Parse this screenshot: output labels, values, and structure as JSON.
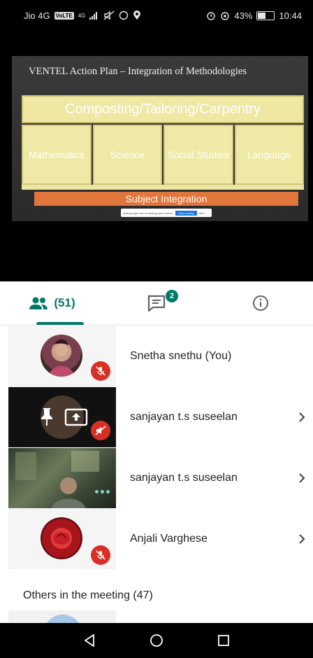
{
  "status_bar": {
    "carrier": "Jio 4G",
    "volte": "VoLTE",
    "network": "4G",
    "battery": "43%",
    "battery_level": 0.43,
    "time": "10:44",
    "icons": [
      "signal-icon",
      "mute-icon",
      "whatsapp-icon",
      "location-icon",
      "alarm-icon",
      "eye-icon"
    ]
  },
  "slide": {
    "title": "VENTEL Action Plan – Integration of Methodologies",
    "main_box": "Composting/Tailoring/Carpentry",
    "subjects": [
      "Mathematics",
      "Science",
      "Social Studies",
      "Language"
    ],
    "bottom_label": "Subject Integration",
    "share_notice": "meet.google.com is sharing your screen.",
    "share_stop": "Stop sharing",
    "share_hide": "Hide"
  },
  "tabs": {
    "people_count": "(51)",
    "chat_badge": "2",
    "icons": [
      "people-icon",
      "chat-icon",
      "info-icon"
    ]
  },
  "participants": [
    {
      "name": "Snetha snethu (You)",
      "muted": true,
      "has_chevron": false
    },
    {
      "name": "sanjayan t.s suseelan",
      "muted": true,
      "has_chevron": true
    },
    {
      "name": "sanjayan t.s suseelan",
      "muted": false,
      "has_chevron": true
    },
    {
      "name": "Anjali Varghese",
      "muted": true,
      "has_chevron": true
    }
  ],
  "others_heading": "Others in the meeting (47)",
  "colors": {
    "accent": "#00796b",
    "mute_red": "#d93025",
    "slide_yellow": "#efe9a6",
    "slide_orange": "#e0763c"
  },
  "nav": {
    "icons": [
      "back-icon",
      "home-icon",
      "recents-icon"
    ]
  }
}
